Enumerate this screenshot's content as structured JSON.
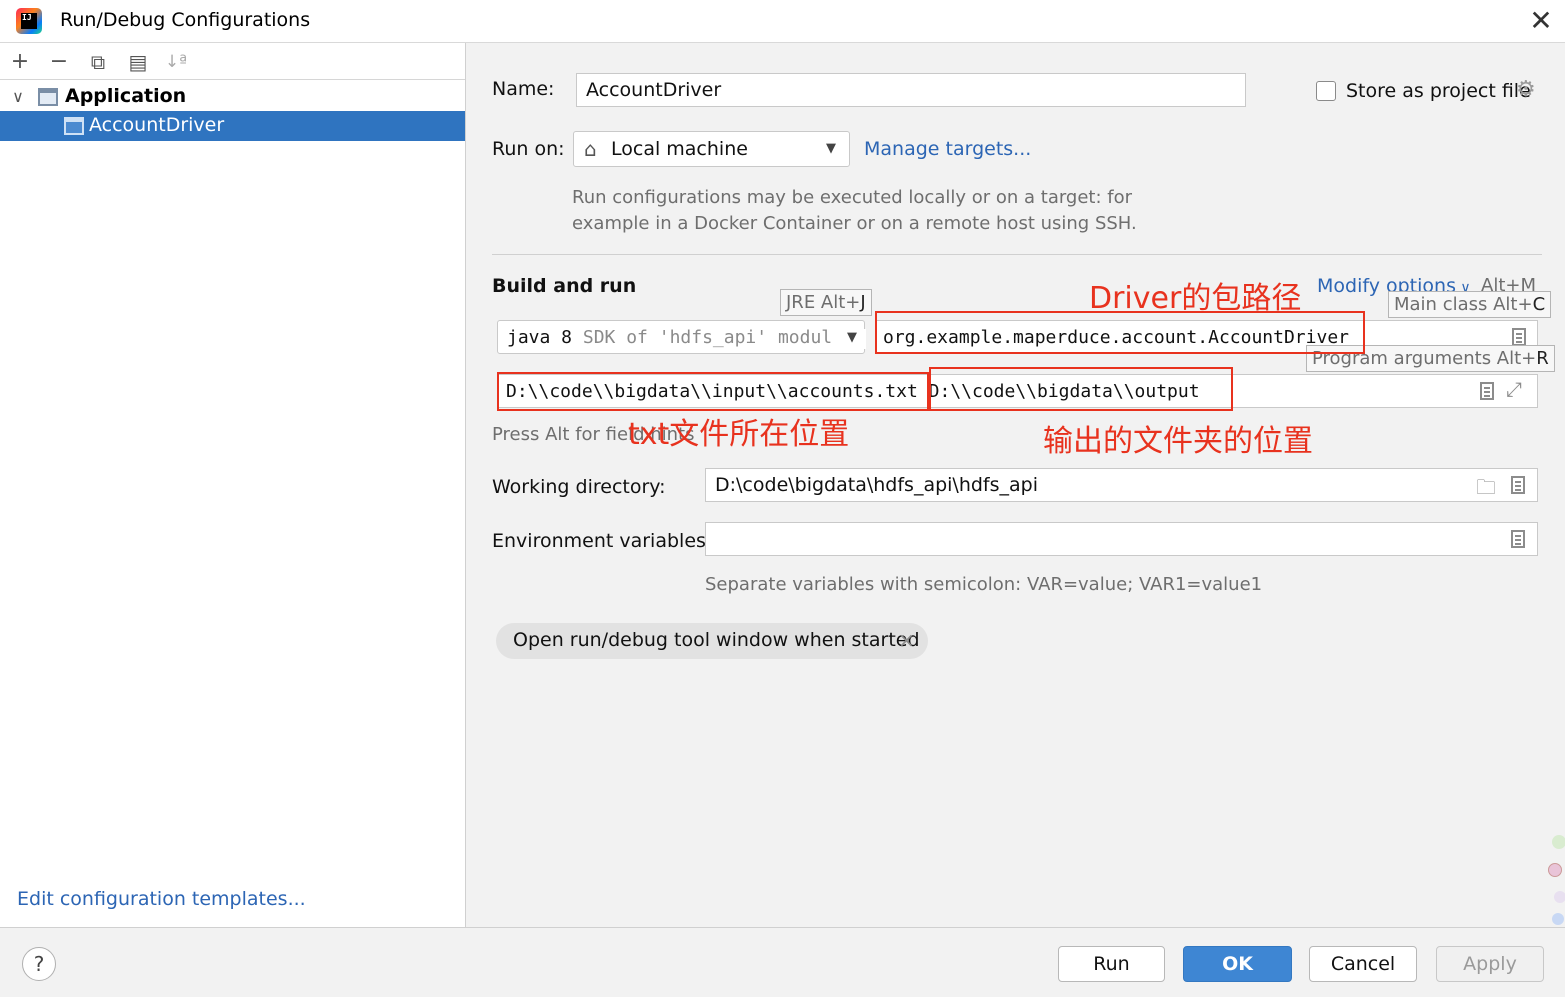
{
  "window": {
    "title": "Run/Debug Configurations",
    "close": "✕"
  },
  "toolbar": {
    "add": "+",
    "remove": "−",
    "copy": "⧉",
    "folder": "▤",
    "sort": "↓ª"
  },
  "tree": {
    "group_label": "Application",
    "item_label": "AccountDriver",
    "chevron": "∨"
  },
  "left": {
    "edit_templates": "Edit configuration templates..."
  },
  "form": {
    "name_label": "Name:",
    "name_value": "AccountDriver",
    "store_label": "Store as project file",
    "run_on_label": "Run on:",
    "run_on_value": "Local machine",
    "manage_targets": "Manage targets...",
    "run_on_hint_1": "Run configurations may be executed locally or on a target: for",
    "run_on_hint_2": "example in a Docker Container or on a remote host using SSH.",
    "build_and_run": "Build and run",
    "modify_options": "Modify options",
    "modify_shortcut": "Alt+M",
    "jre_value_main": "java 8",
    "jre_value_sub": "SDK of 'hdfs_api' modul",
    "main_class_value": "org.example.maperduce.account.AccountDriver",
    "program_args_value": "D:\\\\code\\\\bigdata\\\\input\\\\accounts.txt D:\\\\code\\\\bigdata\\\\output",
    "alt_hint": "Press Alt for field hints",
    "workdir_label": "Working directory:",
    "workdir_value": "D:\\code\\bigdata\\hdfs_api\\hdfs_api",
    "env_label": "Environment variables:",
    "env_value": "",
    "env_hint": "Separate variables with semicolon: VAR=value; VAR1=value1",
    "chip_label": "Open run/debug tool window when started",
    "chip_close": "×"
  },
  "tooltips": {
    "jre_text": "JRE Alt+",
    "jre_key": "J",
    "main_text": "Main class Alt+",
    "main_key": "C",
    "args_text": "Program arguments Alt+",
    "args_key": "R"
  },
  "annotations": {
    "driver_path": "Driver的包路径",
    "txt_location": "txt文件所在位置",
    "output_location": "输出的文件夹的位置"
  },
  "buttons": {
    "help": "?",
    "run": "Run",
    "ok": "OK",
    "cancel": "Cancel",
    "apply": "Apply"
  },
  "colors": {
    "accent": "#2f74c0",
    "link": "#2c65b4",
    "annotation": "#e8321e",
    "primary_button": "#3e86d3"
  }
}
